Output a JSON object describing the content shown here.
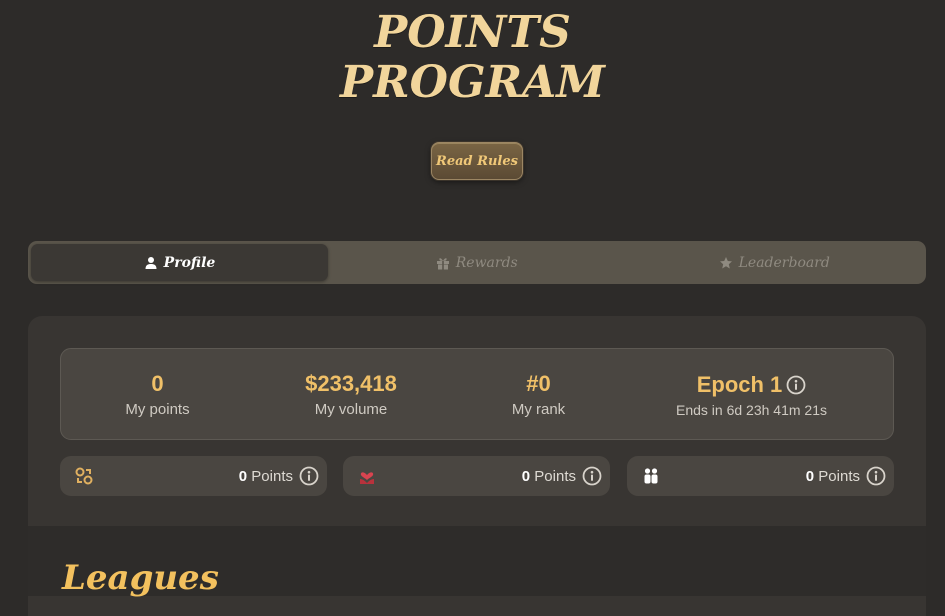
{
  "header": {
    "title_line1": "POINTS",
    "title_line2": "PROGRAM",
    "read_rules_label": "Read Rules"
  },
  "tabs": [
    {
      "label": "Profile",
      "icon": "user-icon",
      "active": true
    },
    {
      "label": "Rewards",
      "icon": "gift-icon",
      "active": false
    },
    {
      "label": "Leaderboard",
      "icon": "star-icon",
      "active": false
    }
  ],
  "stats": {
    "points": {
      "value": "0",
      "label": "My points"
    },
    "volume": {
      "value": "$233,418",
      "label": "My volume"
    },
    "rank": {
      "value": "#0",
      "label": "My rank"
    },
    "epoch": {
      "value": "Epoch 1",
      "label": "Ends in 6d 23h 41m 21s"
    }
  },
  "mini_cards": [
    {
      "icon": "coins-swap-icon",
      "value": "0",
      "unit": "Points",
      "icon_color": "#e0b060"
    },
    {
      "icon": "heart-hands-icon",
      "value": "0",
      "unit": "Points",
      "icon_color": "#d94450"
    },
    {
      "icon": "people-icon",
      "value": "0",
      "unit": "Points",
      "icon_color": "#ffffff"
    }
  ],
  "section": {
    "title": "Leagues"
  },
  "colors": {
    "background": "#2d2b29",
    "accent": "#f0c068",
    "title": "#f1d59b"
  }
}
